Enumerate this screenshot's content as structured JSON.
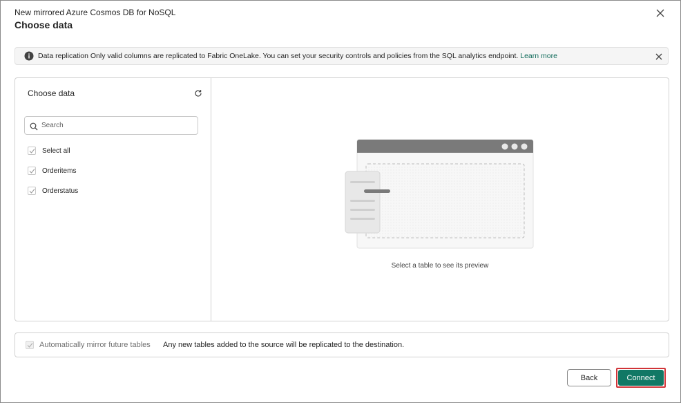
{
  "dialog": {
    "subtitle": "New mirrored Azure Cosmos DB for NoSQL",
    "title": "Choose data",
    "close_icon": "close-icon"
  },
  "banner": {
    "icon": "info-icon",
    "text": "Data replication Only valid columns are replicated to Fabric OneLake. You can set your security controls and policies from the SQL analytics endpoint.",
    "link": "Learn more",
    "close_icon": "close-icon"
  },
  "left_pane": {
    "title": "Choose data",
    "refresh_icon": "refresh-icon",
    "search": {
      "placeholder": "Search",
      "value": ""
    },
    "items": [
      {
        "label": "Select all",
        "checked": true
      },
      {
        "label": "Orderitems",
        "checked": true
      },
      {
        "label": "Orderstatus",
        "checked": true
      }
    ]
  },
  "preview": {
    "empty_text": "Select a table to see its preview"
  },
  "mirror": {
    "label": "Automatically mirror future tables",
    "checked": true,
    "disabled": true,
    "description": "Any new tables added to the source will be replicated to the destination."
  },
  "footer": {
    "back_label": "Back",
    "connect_label": "Connect"
  },
  "colors": {
    "accent": "#117865",
    "highlight": "#d13438",
    "link": "#0f6b5a"
  }
}
